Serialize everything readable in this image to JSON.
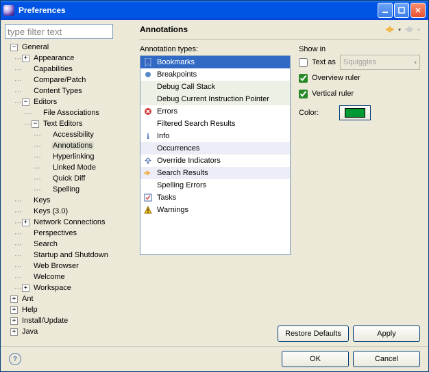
{
  "window": {
    "title": "Preferences"
  },
  "filter_placeholder": "type filter text",
  "tree": {
    "general": "General",
    "appearance": "Appearance",
    "capabilities": "Capabilities",
    "compare": "Compare/Patch",
    "contenttypes": "Content Types",
    "editors": "Editors",
    "fileassoc": "File Associations",
    "texteditors": "Text Editors",
    "accessibility": "Accessibility",
    "annotations": "Annotations",
    "hyperlinking": "Hyperlinking",
    "linkedmode": "Linked Mode",
    "quickdiff": "Quick Diff",
    "spelling": "Spelling",
    "keys": "Keys",
    "keys30": "Keys (3.0)",
    "netconn": "Network Connections",
    "perspectives": "Perspectives",
    "search": "Search",
    "startup": "Startup and Shutdown",
    "webbrowser": "Web Browser",
    "welcome": "Welcome",
    "workspace": "Workspace",
    "ant": "Ant",
    "help": "Help",
    "install": "Install/Update",
    "java": "Java"
  },
  "page": {
    "heading": "Annotations",
    "types_label": "Annotation types:"
  },
  "anno": {
    "bookmarks": "Bookmarks",
    "breakpoints": "Breakpoints",
    "dcs": "Debug Call Stack",
    "dcip": "Debug Current Instruction Pointer",
    "errors": "Errors",
    "fsr": "Filtered Search Results",
    "info": "Info",
    "occ": "Occurrences",
    "override": "Override Indicators",
    "sr": "Search Results",
    "spell": "Spelling Errors",
    "tasks": "Tasks",
    "warnings": "Warnings"
  },
  "show": {
    "showin": "Show in",
    "textas": "Text as",
    "squiggles": "Squiggles",
    "overview": "Overview ruler",
    "vertical": "Vertical ruler",
    "color": "Color:"
  },
  "buttons": {
    "restore": "Restore Defaults",
    "apply": "Apply",
    "ok": "OK",
    "cancel": "Cancel"
  },
  "colors": {
    "swatch": "#009933"
  }
}
